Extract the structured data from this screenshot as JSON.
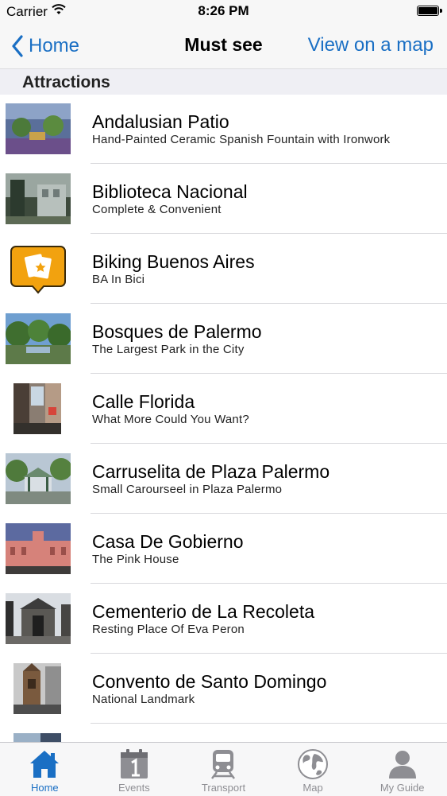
{
  "status_bar": {
    "carrier": "Carrier",
    "time": "8:26 PM"
  },
  "nav": {
    "back_label": "Home",
    "title": "Must see",
    "map_label": "View on a map"
  },
  "section": {
    "title": "Attractions"
  },
  "items": [
    {
      "title": "Andalusian Patio",
      "subtitle": "Hand-Painted Ceramic Spanish Fountain with Ironwork",
      "thumb": "photo"
    },
    {
      "title": "Biblioteca Nacional",
      "subtitle": "Complete & Convenient",
      "thumb": "photo"
    },
    {
      "title": "Biking Buenos Aires",
      "subtitle": "BA In Bici",
      "thumb": "app-icon"
    },
    {
      "title": "Bosques de Palermo",
      "subtitle": "The Largest Park in the City",
      "thumb": "photo"
    },
    {
      "title": "Calle Florida",
      "subtitle": "What More Could You Want?",
      "thumb": "photo"
    },
    {
      "title": "Carruselita de Plaza Palermo",
      "subtitle": "Small Carourseel in Plaza Palermo",
      "thumb": "photo"
    },
    {
      "title": "Casa De Gobierno",
      "subtitle": "The Pink House",
      "thumb": "photo"
    },
    {
      "title": "Cementerio de La Recoleta",
      "subtitle": "Resting Place Of Eva Peron",
      "thumb": "photo"
    },
    {
      "title": "Convento de Santo Domingo",
      "subtitle": "National Landmark",
      "thumb": "photo"
    },
    {
      "title": "",
      "subtitle": "",
      "thumb": "photo"
    }
  ],
  "tabs": [
    {
      "label": "Home",
      "icon": "home-icon",
      "active": true
    },
    {
      "label": "Events",
      "icon": "calendar-icon",
      "active": false
    },
    {
      "label": "Transport",
      "icon": "train-icon",
      "active": false
    },
    {
      "label": "Map",
      "icon": "globe-icon",
      "active": false
    },
    {
      "label": "My Guide",
      "icon": "person-icon",
      "active": false
    }
  ],
  "colors": {
    "accent": "#1a6fc4",
    "inactive_tab": "#8e8e93"
  }
}
